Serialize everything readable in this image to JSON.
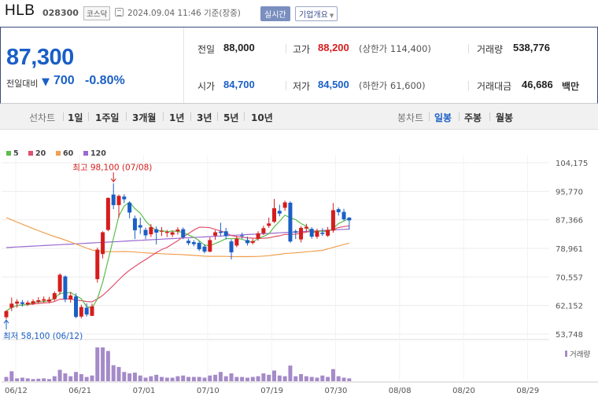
{
  "header": {
    "name": "HLB",
    "code": "028300",
    "market": "코스닥",
    "timestamp": "2024.09.04 11:46 기준(장중)",
    "realtime_label": "실시간",
    "company_label": "기업개요"
  },
  "quote": {
    "price": "87,300",
    "change_label": "전일대비",
    "change_arrow": "▼",
    "change_value": "700",
    "change_pct": "-0.80%",
    "prev_label": "전일",
    "prev_value": "88,000",
    "high_label": "고가",
    "high_value": "88,200",
    "upper_limit_text": "(상한가 114,400)",
    "volume_label": "거래량",
    "volume_value": "538,776",
    "open_label": "시가",
    "open_value": "84,700",
    "low_label": "저가",
    "low_value": "84,500",
    "lower_limit_text": "(하한가 61,600)",
    "amount_label": "거래대금",
    "amount_value": "46,686",
    "amount_unit": "백만"
  },
  "periods": {
    "line_label": "선차트",
    "line_items": [
      "1일",
      "1주일",
      "3개월",
      "1년",
      "3년",
      "5년",
      "10년"
    ],
    "candle_label": "봉차트",
    "candle_items": [
      "일봉",
      "주봉",
      "월봉"
    ],
    "active": "일봉"
  },
  "colors": {
    "up": "#d51d1d",
    "down": "#1a5fc6",
    "ma5": "#5cbd4c",
    "ma20": "#e0506e",
    "ma60": "#f0a050",
    "ma120": "#9a6ad0",
    "volume": "#a58ac8"
  },
  "chart_data": {
    "type": "candlestick",
    "legend": [
      {
        "name": "5",
        "color": "#5cbd4c"
      },
      {
        "name": "20",
        "color": "#e0506e"
      },
      {
        "name": "60",
        "color": "#f0a050"
      },
      {
        "name": "120",
        "color": "#9a6ad0"
      }
    ],
    "y_ticks": [
      "104,175",
      "95,770",
      "87,366",
      "78,961",
      "70,557",
      "62,152",
      "53,748"
    ],
    "ylim": [
      53748,
      104175
    ],
    "x_ticks": [
      "06/12",
      "06/21",
      "07/01",
      "07/10",
      "07/19",
      "07/30",
      "08/08",
      "08/20",
      "08/29"
    ],
    "annotations": {
      "high": "최고 98,100 (07/08)",
      "low": "최저 58,100 (06/12)"
    },
    "volume_label": "거래량",
    "candles": [
      {
        "o": 58700,
        "c": 60500,
        "h": 60800,
        "l": 58100
      },
      {
        "o": 61500,
        "c": 62700,
        "h": 64500,
        "l": 60500
      },
      {
        "o": 62700,
        "c": 63300,
        "h": 64000,
        "l": 61500
      },
      {
        "o": 63100,
        "c": 62600,
        "h": 63800,
        "l": 61800
      },
      {
        "o": 62500,
        "c": 63000,
        "h": 63600,
        "l": 62000
      },
      {
        "o": 62700,
        "c": 63400,
        "h": 64000,
        "l": 62300
      },
      {
        "o": 63200,
        "c": 63700,
        "h": 64600,
        "l": 62800
      },
      {
        "o": 63600,
        "c": 64000,
        "h": 64800,
        "l": 63000
      },
      {
        "o": 63300,
        "c": 63900,
        "h": 64700,
        "l": 62800
      },
      {
        "o": 64000,
        "c": 65800,
        "h": 66300,
        "l": 63500
      },
      {
        "o": 66200,
        "c": 71200,
        "h": 71600,
        "l": 65300
      },
      {
        "o": 70700,
        "c": 64000,
        "h": 71000,
        "l": 63100
      },
      {
        "o": 63900,
        "c": 65100,
        "h": 66100,
        "l": 63000
      },
      {
        "o": 64800,
        "c": 58800,
        "h": 65700,
        "l": 58400
      },
      {
        "o": 58900,
        "c": 61700,
        "h": 62400,
        "l": 58400
      },
      {
        "o": 61500,
        "c": 59500,
        "h": 62800,
        "l": 58900
      },
      {
        "o": 59100,
        "c": 61900,
        "h": 62700,
        "l": 59100
      },
      {
        "o": 69900,
        "c": 78600,
        "h": 79200,
        "l": 68900
      },
      {
        "o": 77300,
        "c": 83700,
        "h": 84000,
        "l": 76000
      },
      {
        "o": 84400,
        "c": 93800,
        "h": 94000,
        "l": 84000
      },
      {
        "o": 94800,
        "c": 91700,
        "h": 98100,
        "l": 90500
      },
      {
        "o": 91700,
        "c": 94400,
        "h": 94800,
        "l": 88000
      },
      {
        "o": 94200,
        "c": 93400,
        "h": 94900,
        "l": 92300
      },
      {
        "o": 92400,
        "c": 89500,
        "h": 92800,
        "l": 87800
      },
      {
        "o": 87800,
        "c": 84300,
        "h": 88600,
        "l": 81700
      },
      {
        "o": 85800,
        "c": 85100,
        "h": 88000,
        "l": 83200
      },
      {
        "o": 84400,
        "c": 82800,
        "h": 85100,
        "l": 81700
      },
      {
        "o": 83100,
        "c": 85200,
        "h": 86100,
        "l": 82300
      },
      {
        "o": 84600,
        "c": 83600,
        "h": 85400,
        "l": 80100
      },
      {
        "o": 84000,
        "c": 84100,
        "h": 85200,
        "l": 82600
      },
      {
        "o": 83500,
        "c": 83800,
        "h": 84400,
        "l": 82300
      },
      {
        "o": 83000,
        "c": 83700,
        "h": 84200,
        "l": 82300
      },
      {
        "o": 84000,
        "c": 84500,
        "h": 85200,
        "l": 83000
      },
      {
        "o": 84600,
        "c": 82200,
        "h": 85100,
        "l": 81700
      },
      {
        "o": 81200,
        "c": 80500,
        "h": 81800,
        "l": 79900
      },
      {
        "o": 80800,
        "c": 80200,
        "h": 81400,
        "l": 79600
      },
      {
        "o": 80600,
        "c": 78700,
        "h": 81100,
        "l": 78200
      },
      {
        "o": 79500,
        "c": 78000,
        "h": 80200,
        "l": 77500
      },
      {
        "o": 78000,
        "c": 81400,
        "h": 82200,
        "l": 77800
      },
      {
        "o": 82700,
        "c": 83700,
        "h": 84300,
        "l": 81500
      },
      {
        "o": 83900,
        "c": 83500,
        "h": 86500,
        "l": 82500
      },
      {
        "o": 84000,
        "c": 82600,
        "h": 85000,
        "l": 81600
      },
      {
        "o": 81000,
        "c": 77800,
        "h": 81600,
        "l": 75700
      },
      {
        "o": 79800,
        "c": 81800,
        "h": 82600,
        "l": 79300
      },
      {
        "o": 82800,
        "c": 82600,
        "h": 83600,
        "l": 81800
      },
      {
        "o": 81400,
        "c": 80500,
        "h": 82400,
        "l": 79800
      },
      {
        "o": 80600,
        "c": 81100,
        "h": 81800,
        "l": 80100
      },
      {
        "o": 81800,
        "c": 83400,
        "h": 84000,
        "l": 81200
      },
      {
        "o": 83400,
        "c": 84900,
        "h": 85600,
        "l": 82900
      },
      {
        "o": 85600,
        "c": 86300,
        "h": 88000,
        "l": 85000
      },
      {
        "o": 86800,
        "c": 90800,
        "h": 93500,
        "l": 86400
      },
      {
        "o": 90000,
        "c": 89200,
        "h": 91800,
        "l": 88400
      },
      {
        "o": 90900,
        "c": 92500,
        "h": 93000,
        "l": 90000
      },
      {
        "o": 92400,
        "c": 81000,
        "h": 92800,
        "l": 80600
      },
      {
        "o": 84000,
        "c": 83600,
        "h": 84500,
        "l": 81700
      },
      {
        "o": 81600,
        "c": 85000,
        "h": 85500,
        "l": 80700
      },
      {
        "o": 84800,
        "c": 85300,
        "h": 86200,
        "l": 83700
      },
      {
        "o": 84700,
        "c": 82400,
        "h": 85200,
        "l": 81800
      },
      {
        "o": 82400,
        "c": 84000,
        "h": 84800,
        "l": 81800
      },
      {
        "o": 83600,
        "c": 83200,
        "h": 84900,
        "l": 82600
      },
      {
        "o": 82700,
        "c": 84400,
        "h": 85300,
        "l": 82300
      },
      {
        "o": 84200,
        "c": 90200,
        "h": 92300,
        "l": 83600
      },
      {
        "o": 90500,
        "c": 89600,
        "h": 91000,
        "l": 88600
      },
      {
        "o": 89700,
        "c": 87500,
        "h": 90600,
        "l": 87100
      },
      {
        "o": 88000,
        "c": 87200,
        "h": 88200,
        "l": 84500
      }
    ],
    "volume": [
      12,
      28,
      8,
      10,
      8,
      6,
      7,
      8,
      6,
      14,
      32,
      22,
      14,
      26,
      20,
      12,
      16,
      95,
      95,
      85,
      45,
      40,
      26,
      22,
      24,
      16,
      10,
      14,
      18,
      12,
      10,
      10,
      14,
      16,
      12,
      12,
      12,
      10,
      16,
      18,
      26,
      14,
      22,
      12,
      12,
      10,
      12,
      14,
      22,
      18,
      30,
      16,
      14,
      44,
      14,
      20,
      14,
      12,
      10,
      16,
      12,
      34,
      14,
      10,
      8
    ]
  }
}
